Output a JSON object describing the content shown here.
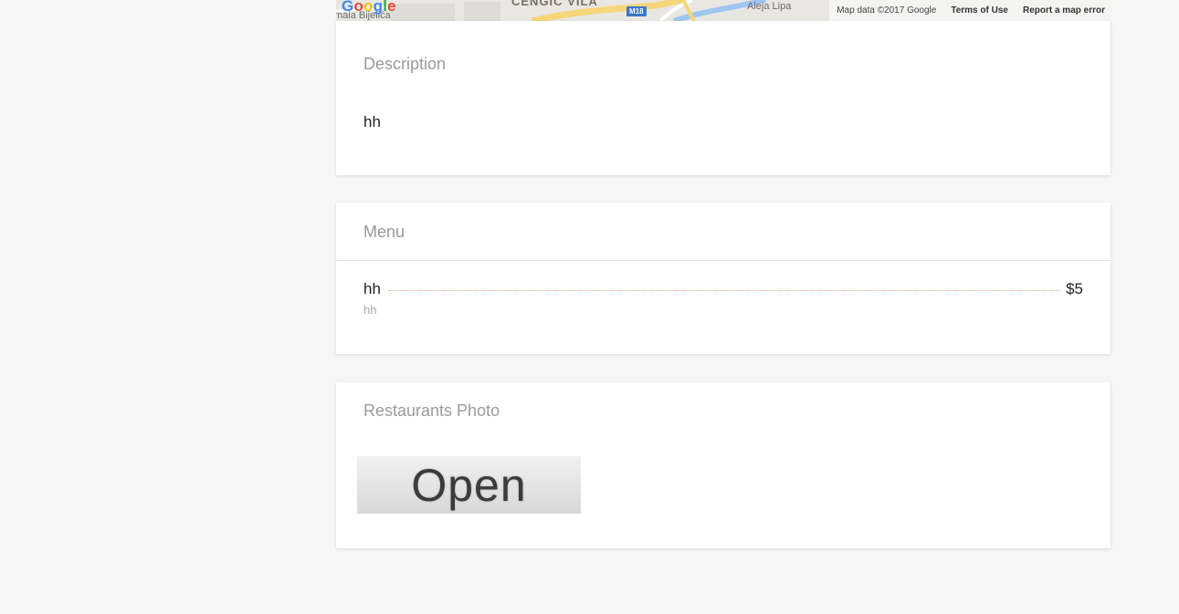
{
  "map": {
    "district": "CENGIC VILA",
    "street_left": "maia Bijelića",
    "street_right": "Aleja Lipa",
    "route_label": "M18",
    "logo": [
      "G",
      "o",
      "o",
      "g",
      "l",
      "e"
    ],
    "attribution": "Map data ©2017 Google",
    "terms": "Terms of Use",
    "report": "Report a map error"
  },
  "description": {
    "title": "Description",
    "text": "hh"
  },
  "menu": {
    "title": "Menu",
    "items": [
      {
        "name": "hh",
        "price": "$5",
        "description": "hh"
      }
    ]
  },
  "photos": {
    "title": "Restaurants Photo",
    "image_text": "Open"
  }
}
